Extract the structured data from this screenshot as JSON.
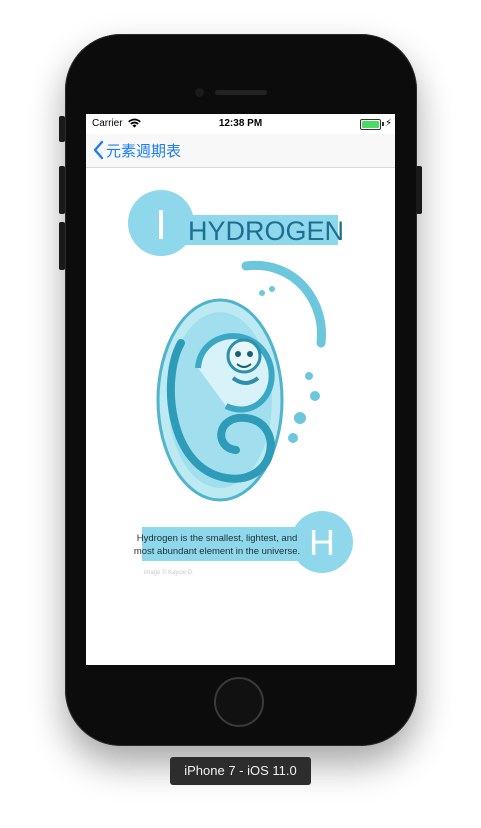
{
  "device_label": "iPhone 7 - iOS 11.0",
  "status_bar": {
    "carrier": "Carrier",
    "time": "12:38 PM"
  },
  "nav": {
    "back_label": "元素週期表"
  },
  "card": {
    "title": "HYDROGEN",
    "atomic_number": "I",
    "symbol": "H",
    "description_line1": "Hydrogen is the smallest, lightest, and",
    "description_line2": "most abundant element in the universe.",
    "credit": "image © Kaycie D."
  },
  "colors": {
    "accent_blue": "#1a7cf6",
    "card_cyan": "#8fd8ec",
    "title_blue": "#1b6f92",
    "battery_green": "#4cd964"
  }
}
